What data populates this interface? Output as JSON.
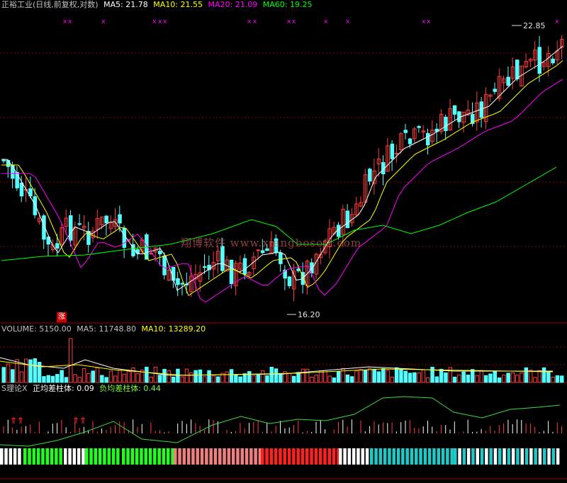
{
  "main_panel": {
    "legend": {
      "title": "正裕工业(日线,前复权,对数)",
      "ma5_label": "MA5: 21.78",
      "ma10_label": "MA10: 21.55",
      "ma20_label": "MA20: 21.09",
      "ma60_label": "MA60: 19.25"
    },
    "high_label": "22.85",
    "low_label": "16.20",
    "badge": "涨",
    "watermark": "翔博软件 www.xiangbosoft.com"
  },
  "volume_panel": {
    "legend": {
      "title": "VOLUME: 5150.00",
      "ma5_label": "MA5: 11748.80",
      "ma10_label": "MA10: 13289.20"
    }
  },
  "indicator_panel": {
    "legend": {
      "title": "S理论X",
      "pos_label": "正均差柱体: 0.09",
      "neg_label": "负均差柱体: 0.44"
    }
  },
  "colors": {
    "up": "#ff3b3b",
    "down": "#54ffff",
    "ma5": "#ffffff",
    "ma10": "#ffff00",
    "ma20": "#ff00ff",
    "ma60": "#00ff00",
    "grid": "#8b0000",
    "legend_title": "#c0c0c0"
  }
}
